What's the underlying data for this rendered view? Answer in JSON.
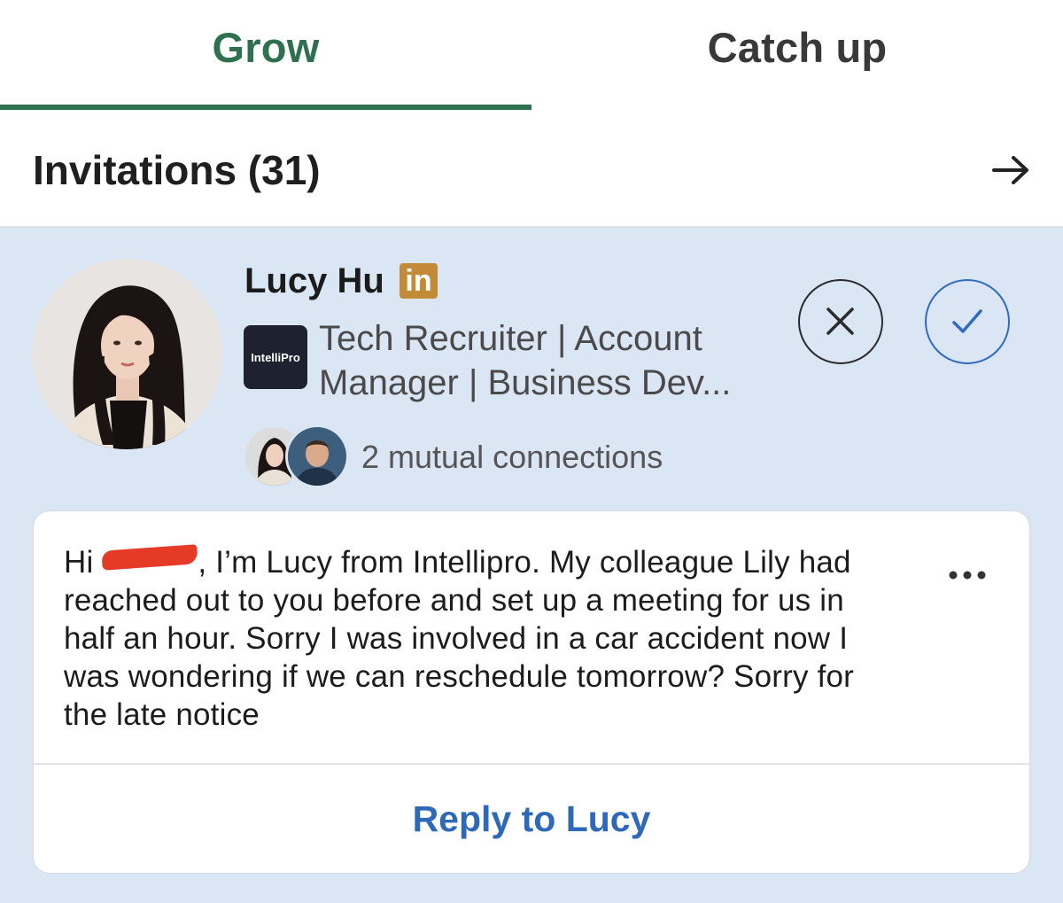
{
  "tabs": {
    "grow": "Grow",
    "catch_up": "Catch up",
    "active": "Grow",
    "active_color": "#2f7050"
  },
  "invitations": {
    "title": "Invitations (31)",
    "arrow_icon": "arrow-right-icon"
  },
  "invitation": {
    "name": "Lucy Hu",
    "badge": "in",
    "badge_color": "#c38b38",
    "company_logo_text": "IntelliPro",
    "headline": "Tech Recruiter | Account Manager | Business Dev...",
    "mutual_connections": "2 mutual connections",
    "ignore_icon": "close-icon",
    "accept_icon": "check-icon",
    "accept_color": "#2f6cc0",
    "background_color": "#dbe6f5"
  },
  "message": {
    "greeting": "Hi",
    "body": ", I’m Lucy from Intellipro. My colleague Lily had reached out to you before and set up a meeting for us in half an hour. Sorry I was involved in a car accident now I was wondering if we can reschedule tomorrow? Sorry for the late notice",
    "more_icon": "more-horizontal-icon",
    "reply_label": "Reply to Lucy",
    "reply_color": "#2e68b8"
  }
}
